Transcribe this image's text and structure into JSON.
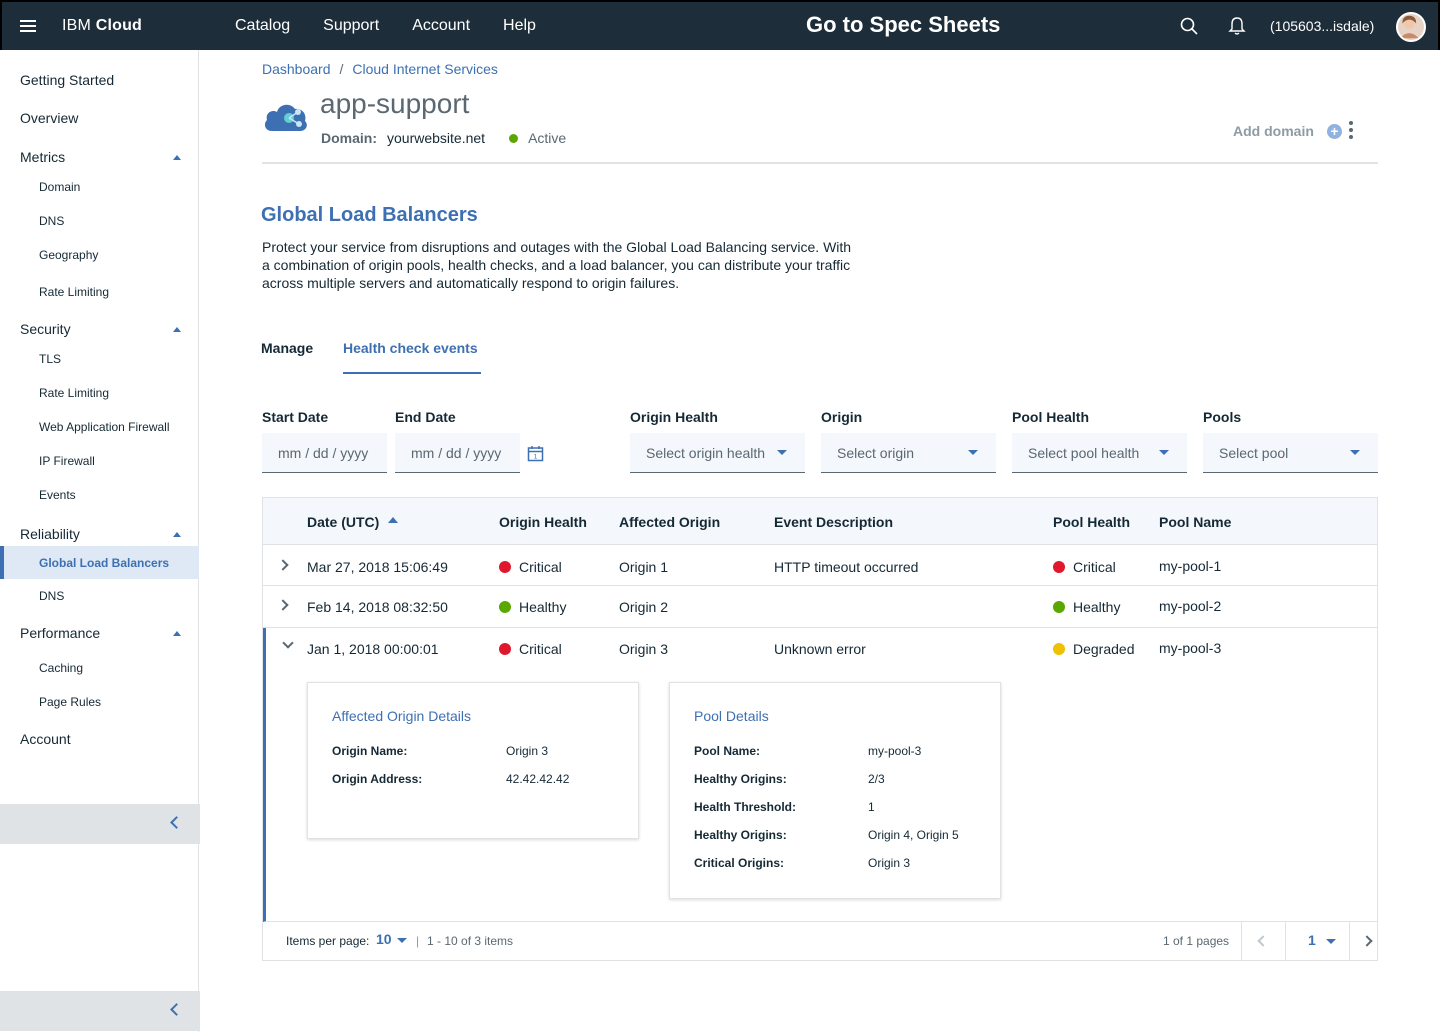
{
  "topbar": {
    "brand_prefix": "IBM",
    "brand_bold": "Cloud",
    "nav": [
      "Catalog",
      "Support",
      "Account",
      "Help"
    ],
    "spec_link": "Go to Spec Sheets",
    "account_id": "(105603...isdale)",
    "icons": [
      "hamburger-icon",
      "search-icon",
      "bell-icon",
      "avatar"
    ]
  },
  "sidebar": {
    "getting_started": "Getting Started",
    "overview": "Overview",
    "metrics": "Metrics",
    "metrics_items": [
      "Domain",
      "DNS",
      "Geography",
      "Rate Limiting"
    ],
    "security": "Security",
    "security_items": [
      "TLS",
      "Rate Limiting",
      "Web Application Firewall",
      "IP Firewall",
      "Events"
    ],
    "reliability": "Reliability",
    "reliability_items": [
      "Global Load Balancers",
      "DNS"
    ],
    "performance": "Performance",
    "performance_items": [
      "Caching",
      "Page Rules"
    ],
    "account": "Account"
  },
  "breadcrumb": [
    "Dashboard",
    "Cloud Internet Services"
  ],
  "header": {
    "title": "app-support",
    "domain_label": "Domain:",
    "domain_value": "yourwebsite.net",
    "status": "Active",
    "status_color": "#5aa700",
    "add_domain": "Add domain"
  },
  "section": {
    "title": "Global Load Balancers",
    "description": "Protect your service from disruptions and outages with the Global Load Balancing service. With a combination of origin pools, health checks, and a load balancer, you can distribute your traffic across multiple servers and automatically respond to origin failures."
  },
  "tabs": [
    "Manage",
    "Health check events"
  ],
  "filters": {
    "start_date_label": "Start Date",
    "start_date_placeholder": "mm / dd / yyyy",
    "end_date_label": "End Date",
    "end_date_placeholder": "mm / dd / yyyy",
    "origin_health_label": "Origin Health",
    "origin_health_placeholder": "Select origin health",
    "origin_label": "Origin",
    "origin_placeholder": "Select origin",
    "pool_health_label": "Pool Health",
    "pool_health_placeholder": "Select pool health",
    "pools_label": "Pools",
    "pools_placeholder": "Select pool"
  },
  "table": {
    "columns": [
      "Date (UTC)",
      "Origin Health",
      "Affected Origin",
      "Event Description",
      "Pool Health",
      "Pool Name"
    ],
    "rows": [
      {
        "date": "Mar 27, 2018 15:06:49",
        "origin_health": "Critical",
        "origin_health_color": "#e0182d",
        "origin": "Origin 1",
        "description": "HTTP timeout occurred",
        "pool_health": "Critical",
        "pool_health_color": "#e0182d",
        "pool": "my-pool-1"
      },
      {
        "date": "Feb 14, 2018 08:32:50",
        "origin_health": "Healthy",
        "origin_health_color": "#5aa700",
        "origin": "Origin 2",
        "description": "",
        "pool_health": "Healthy",
        "pool_health_color": "#5aa700",
        "pool": "my-pool-2"
      },
      {
        "date": "Jan 1, 2018 00:00:01",
        "origin_health": "Critical",
        "origin_health_color": "#e0182d",
        "origin": "Origin 3",
        "description": "Unknown error",
        "pool_health": "Degraded",
        "pool_health_color": "#efc100",
        "pool": "my-pool-3"
      }
    ],
    "expanded": {
      "origin_title": "Affected Origin Details",
      "origin_fields": [
        {
          "k": "Origin Name:",
          "v": "Origin 3"
        },
        {
          "k": "Origin Address:",
          "v": "42.42.42.42"
        }
      ],
      "pool_title": "Pool Details",
      "pool_fields": [
        {
          "k": "Pool Name:",
          "v": "my-pool-3"
        },
        {
          "k": "Healthy Origins:",
          "v": "2/3"
        },
        {
          "k": "Health Threshold:",
          "v": "1"
        },
        {
          "k": "Healthy Origins:",
          "v": "Origin 4, Origin 5"
        },
        {
          "k": "Critical Origins:",
          "v": "Origin 3"
        }
      ]
    },
    "pagination": {
      "items_per_page_label": "Items per page:",
      "items_per_page": "10",
      "separator": "|",
      "range": "1 - 10 of 3 items",
      "pages": "1 of 1 pages",
      "current_page": "1"
    }
  }
}
